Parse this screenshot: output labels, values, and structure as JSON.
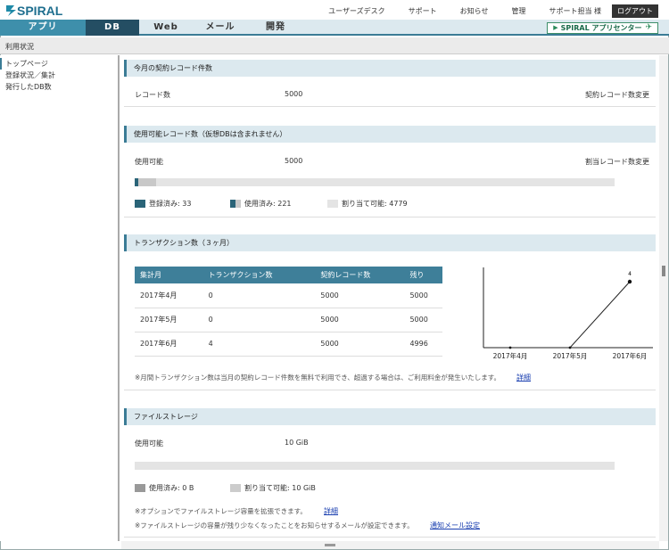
{
  "header": {
    "logo": "SPIRAL",
    "links": [
      "ユーザーズデスク",
      "サポート",
      "お知らせ",
      "管理",
      "サポート担当 様"
    ],
    "logout": "ログアウト"
  },
  "nav": {
    "tabs": [
      "アプリ",
      "DB",
      "Web",
      "メール",
      "開発"
    ],
    "app_center": "SPIRAL アプリセンター"
  },
  "subbar": {
    "title": "利用状況"
  },
  "sidebar": {
    "items": [
      "トップページ",
      "登録状況／集計",
      "発行したDB数"
    ]
  },
  "records": {
    "title": "今月の契約レコード件数",
    "label": "レコード数",
    "value": "5000",
    "link": "契約レコード数変更"
  },
  "usable": {
    "title": "使用可能レコード数（仮想DBは含まれません）",
    "label": "使用可能",
    "value": "5000",
    "link": "割当レコード数変更",
    "registered_fraction": 0.0066,
    "used_fraction": 0.0442,
    "legend_registered": "登録済み: 33",
    "legend_used": "使用済み: 221",
    "legend_assignable": "割り当て可能: 4779"
  },
  "transactions": {
    "title": "トランザクション数（３ヶ月）",
    "headers": [
      "集計月",
      "トランザクション数",
      "契約レコード数",
      "残り"
    ],
    "rows": [
      [
        "2017年4月",
        "0",
        "5000",
        "5000"
      ],
      [
        "2017年5月",
        "0",
        "5000",
        "5000"
      ],
      [
        "2017年6月",
        "4",
        "5000",
        "4996"
      ]
    ],
    "note": "※月間トランザクション数は当月の契約レコード件数を無料で利用でき、超過する場合は、ご利用料金が発生いたします。",
    "note_link": "詳細"
  },
  "chart_data": {
    "type": "line",
    "categories": [
      "2017年4月",
      "2017年5月",
      "2017年6月"
    ],
    "values": [
      0,
      0,
      4
    ],
    "data_labels": [
      "",
      "",
      "4"
    ],
    "ylim": [
      0,
      4
    ]
  },
  "storage": {
    "title": "ファイルストレージ",
    "label": "使用可能",
    "value": "10 GiB",
    "used_fraction": 0,
    "legend_used": "使用済み: 0 B",
    "legend_assignable": "割り当て可能: 10 GiB",
    "note1": "※オプションでファイルストレージ容量を拡張できます。",
    "note1_link": "詳細",
    "note2": "※ファイルストレージの容量が残り少なくなったことをお知らせするメールが設定できます。",
    "note2_link": "通知メール設定"
  },
  "colors": {
    "accent": "#3b7c96",
    "nav_app": "#3e8fab",
    "nav_db": "#244e63",
    "section_bg": "#dce9ef",
    "registered": "#2a6478",
    "used": "#c8c8c8",
    "assignable": "#e4e4e4",
    "storage_used": "#999999"
  }
}
